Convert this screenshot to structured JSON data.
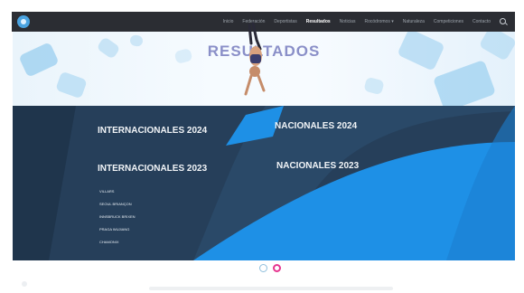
{
  "nav": {
    "items": [
      {
        "label": "Inicio"
      },
      {
        "label": "Federación"
      },
      {
        "label": "Deportistas"
      },
      {
        "label": "Resultados"
      },
      {
        "label": "Noticias"
      },
      {
        "label": "Rocódromos ▾"
      },
      {
        "label": "Naturaleza"
      },
      {
        "label": "Competiciones"
      },
      {
        "label": "Contacto"
      }
    ],
    "active_index": 3
  },
  "hero": {
    "title": "RESULTADOS"
  },
  "results": {
    "columns": [
      {
        "title": "INTERNACIONALES 2024"
      },
      {
        "title": "NACIONALES 2024"
      },
      {
        "title": "INTERNACIONALES 2023"
      },
      {
        "title": "NACIONALES 2023"
      }
    ],
    "internacionales_2023_items": [
      "VILLARS",
      "SEOUL BRIANÇON",
      "INNSBRUCK BRIXEN",
      "PRAGA WUJIANG",
      "CHAMONIX"
    ]
  },
  "colors": {
    "nav_bg": "#2b2d33",
    "panel_bg": "#263f5a",
    "accent_blue": "#1e90e6",
    "title_purple": "#8a8fc8",
    "dot_active": "#e6358f"
  }
}
